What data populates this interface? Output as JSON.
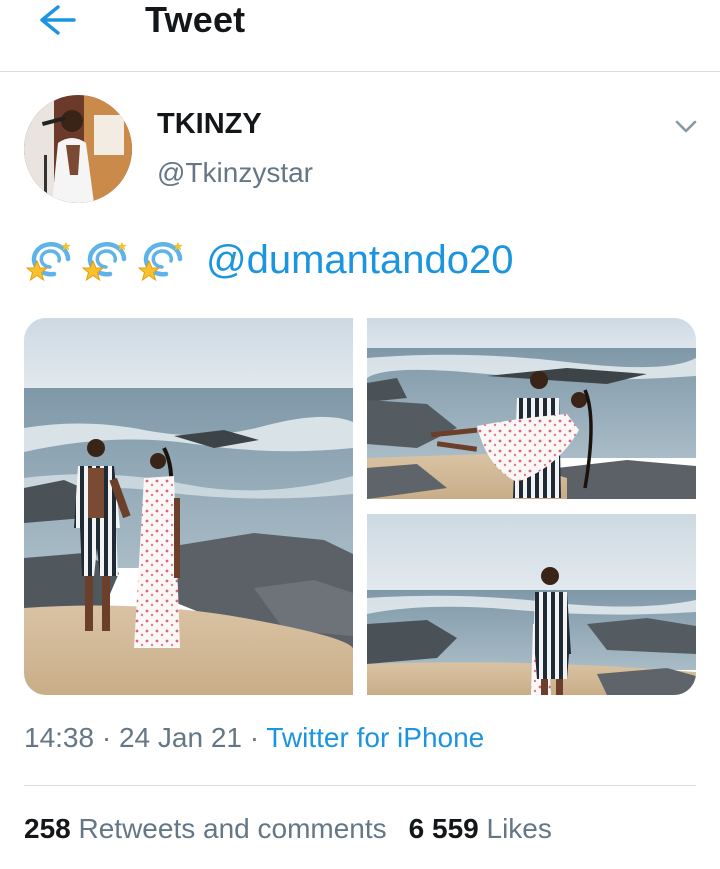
{
  "header": {
    "title": "Tweet",
    "back_icon": "arrow-left-icon",
    "accent": "#1b95e0"
  },
  "author": {
    "display_name": "TKINZY",
    "handle": "@Tkinzystar",
    "avatar_icon": "avatar",
    "menu_icon": "chevron-down-icon"
  },
  "tweet": {
    "emoji_count": 3,
    "emoji_name": "dizzy-icon",
    "mention": "@dumantando20"
  },
  "media": [
    {
      "name": "photo-couple-on-beach-rocks"
    },
    {
      "name": "photo-man-carrying-woman"
    },
    {
      "name": "photo-couple-facing-sea"
    }
  ],
  "meta": {
    "time": "14:38",
    "separator": " · ",
    "date": "24 Jan 21",
    "source": "Twitter for iPhone"
  },
  "stats": {
    "retweets_count": "258",
    "retweets_label": "Retweets and comments",
    "likes_count": "6 559",
    "likes_label": "Likes"
  },
  "colors": {
    "text_primary": "#14171a",
    "text_secondary": "#657786",
    "link": "#1b95e0",
    "divider": "#d8dde1"
  }
}
